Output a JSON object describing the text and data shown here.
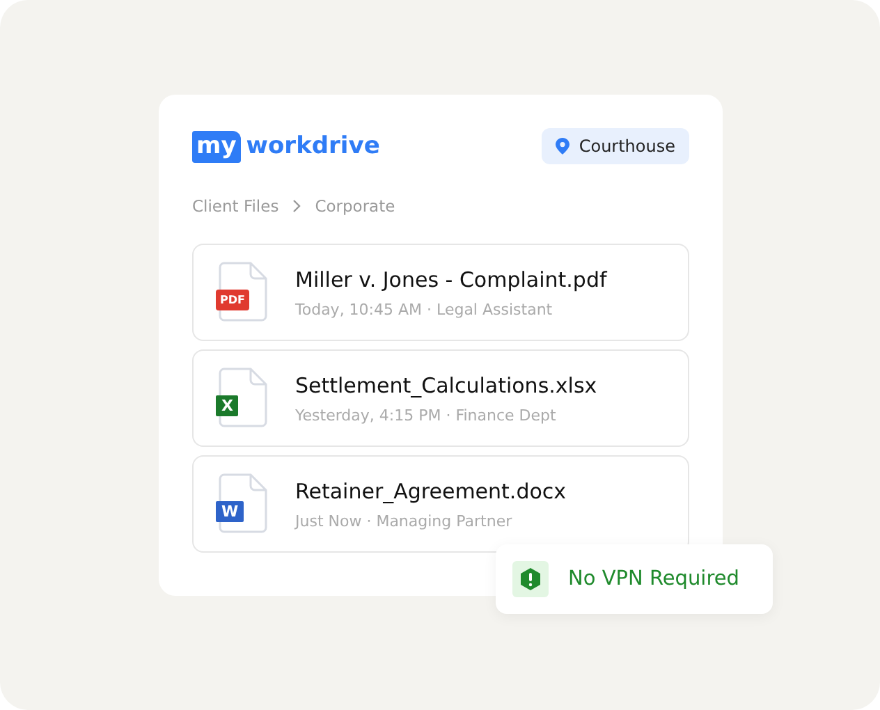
{
  "logo": {
    "mark": "my",
    "word": "workdrive"
  },
  "location": {
    "label": "Courthouse"
  },
  "breadcrumb": [
    "Client Files",
    "Corporate"
  ],
  "files": [
    {
      "name": "Miller v. Jones - Complaint.pdf",
      "meta": "Today, 10:45 AM · Legal Assistant",
      "kind": "pdf",
      "badge": "PDF"
    },
    {
      "name": "Settlement_Calculations.xlsx",
      "meta": "Yesterday, 4:15 PM · Finance Dept",
      "kind": "xlsx",
      "badge": "X"
    },
    {
      "name": "Retainer_Agreement.docx",
      "meta": "Just Now · Managing Partner",
      "kind": "docx",
      "badge": "W"
    }
  ],
  "toast": {
    "label": "No VPN Required"
  }
}
